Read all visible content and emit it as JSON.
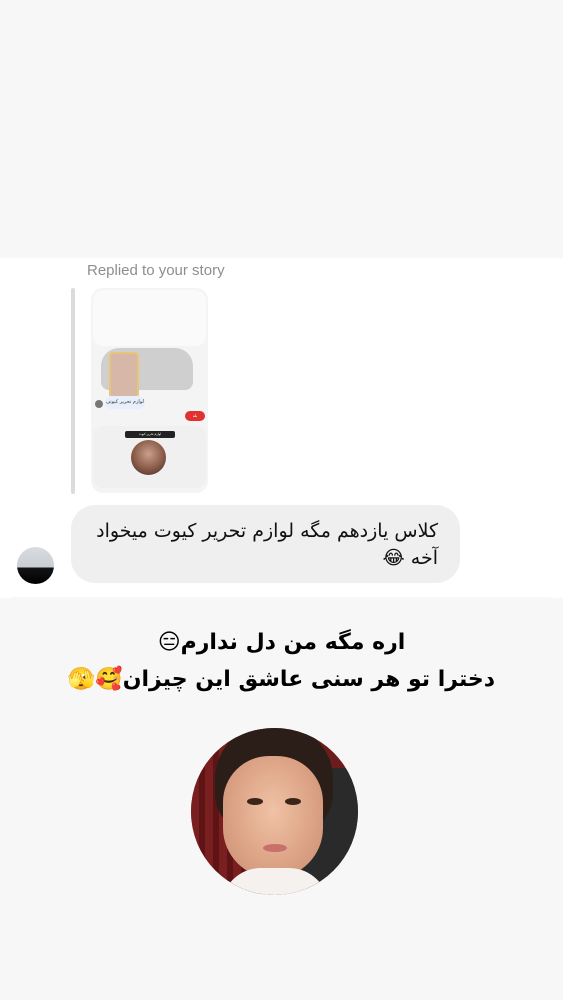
{
  "reply": {
    "label": "Replied to your story",
    "story_preview": {
      "chip_text": "لوازم تحریر کیوتی",
      "red_chip_text": "بله",
      "card_caption": "لوازم تحریر کیوت"
    }
  },
  "message": {
    "text": "کلاس یازدهم مگه لوازم تحریر کیوت میخواد آخه 😂"
  },
  "story_caption": {
    "line1": "اره مگه من دل ندارم😑",
    "line2": "دخترا تو هر سنی عاشق این چیزان🥰🫣"
  }
}
